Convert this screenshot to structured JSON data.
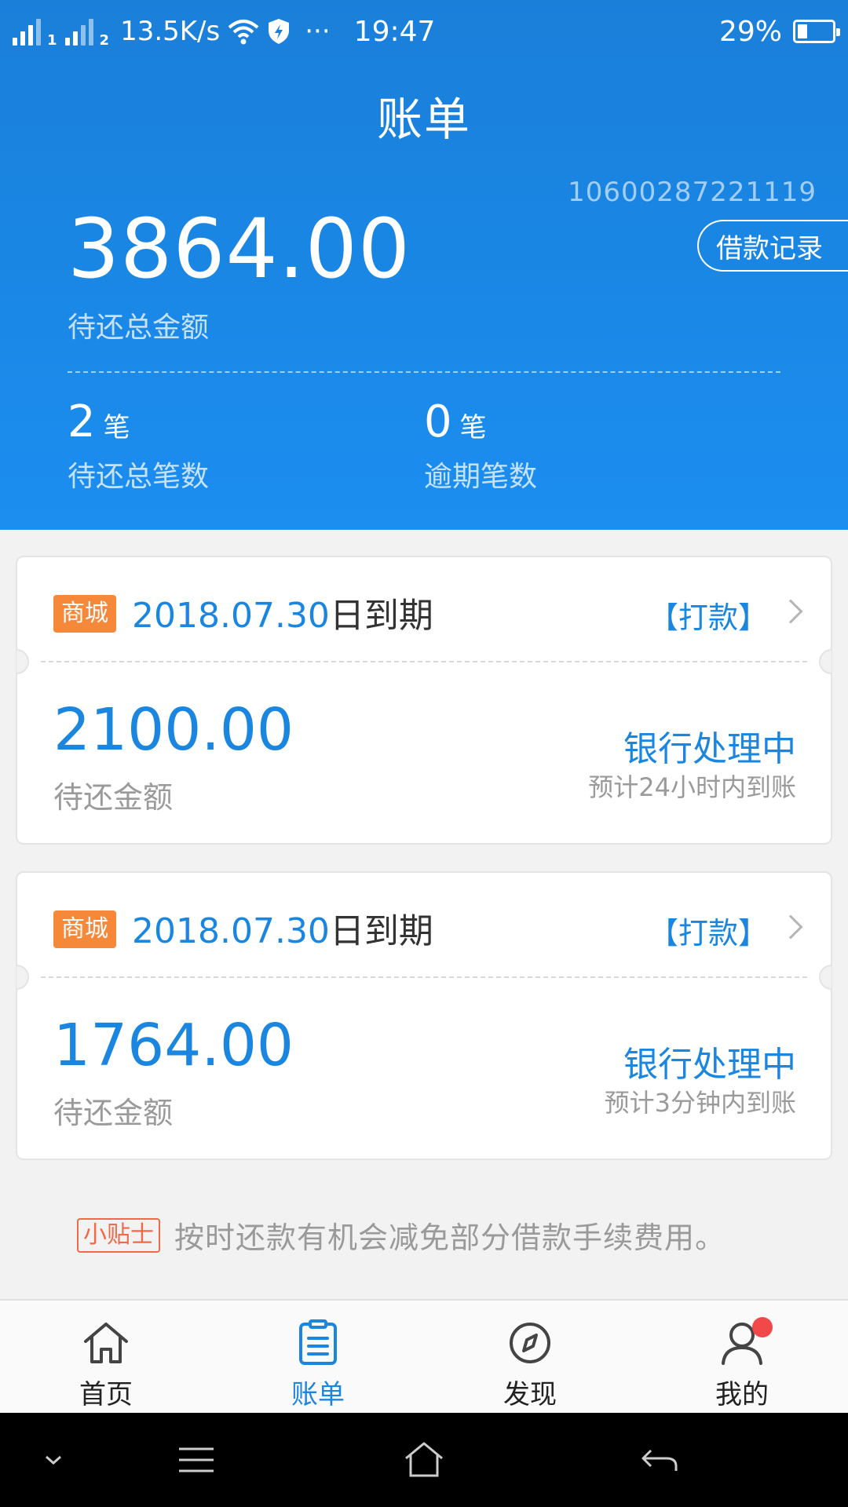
{
  "status_bar": {
    "sim1": "1",
    "sim2": "2",
    "speed": "13.5K/s",
    "more": "···",
    "time": "19:47",
    "battery_percent": "29%",
    "battery_level": 0.29
  },
  "header": {
    "title": "账单",
    "account_no": "10600287221119",
    "loan_record_label": "借款记录",
    "total_amount": "3864.00",
    "total_label": "待还总金额",
    "pending_count": "2",
    "pending_unit": "笔",
    "pending_label": "待还总笔数",
    "overdue_count": "0",
    "overdue_unit": "笔",
    "overdue_label": "逾期笔数"
  },
  "bills": [
    {
      "tag": "商城",
      "due_date": "2018.07.30",
      "due_suffix": "日到期",
      "action": "【打款】",
      "amount": "2100.00",
      "amount_label": "待还金额",
      "status": "银行处理中",
      "eta": "预计24小时内到账"
    },
    {
      "tag": "商城",
      "due_date": "2018.07.30",
      "due_suffix": "日到期",
      "action": "【打款】",
      "amount": "1764.00",
      "amount_label": "待还金额",
      "status": "银行处理中",
      "eta": "预计3分钟内到账"
    }
  ],
  "tip": {
    "badge": "小贴士",
    "text": "按时还款有机会减免部分借款手续费用。"
  },
  "tabs": [
    {
      "label": "首页",
      "icon": "home-icon"
    },
    {
      "label": "账单",
      "icon": "bill-icon",
      "active": true
    },
    {
      "label": "发现",
      "icon": "compass-icon"
    },
    {
      "label": "我的",
      "icon": "user-icon"
    }
  ],
  "colors": {
    "brand_blue": "#1a86df",
    "tag_orange": "#f6883a",
    "tip_red": "#f06a4a",
    "notify_red": "#f2484a"
  }
}
